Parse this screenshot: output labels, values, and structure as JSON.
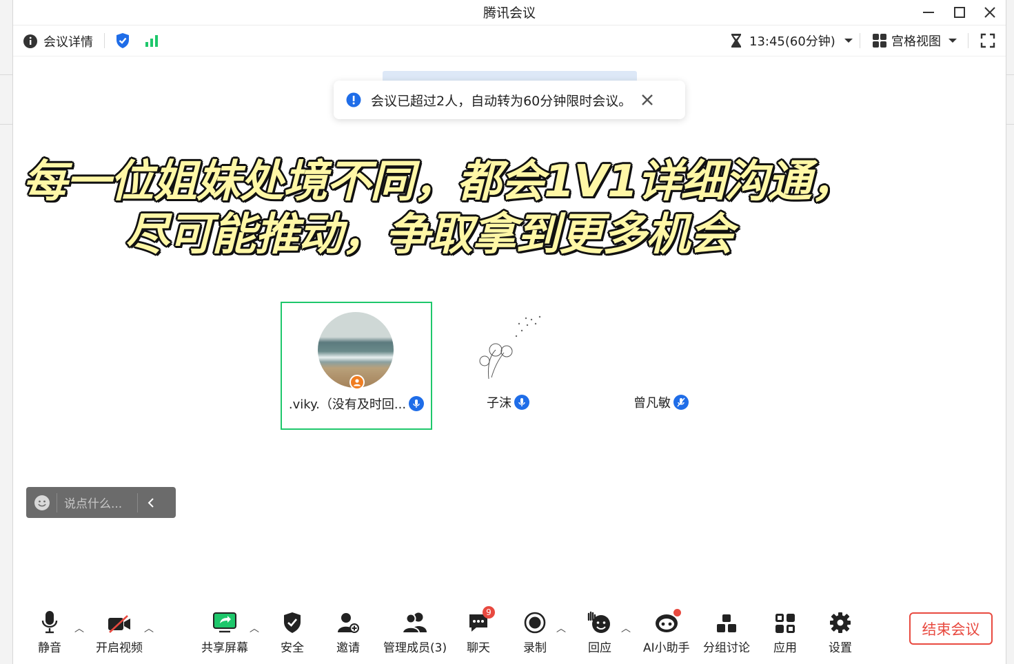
{
  "window": {
    "title": "腾讯会议"
  },
  "infobar": {
    "meeting_details": "会议详情",
    "timer": "13:45(60分钟)",
    "view_mode": "宫格视图"
  },
  "toast": {
    "message": "会议已超过2人，自动转为60分钟限时会议。"
  },
  "banner": {
    "line1": "每一位姐妹处境不同，都会1V1详细沟通，",
    "line2": "尽可能推动，争取拿到更多机会"
  },
  "participants": [
    {
      "name": ".viky.（没有及时回..."
    },
    {
      "name": "子沫"
    },
    {
      "name": "曾凡敏"
    }
  ],
  "chat": {
    "placeholder": "说点什么..."
  },
  "toolbar": {
    "mute": "静音",
    "video": "开启视频",
    "share": "共享屏幕",
    "security": "安全",
    "invite": "邀请",
    "members": "管理成员(3)",
    "chat": "聊天",
    "chat_badge": "9",
    "record": "录制",
    "react": "回应",
    "ai": "AI小助手",
    "breakout": "分组讨论",
    "apps": "应用",
    "settings": "设置",
    "end": "结束会议"
  },
  "colors": {
    "accent_green": "#1ec76b",
    "mic_blue": "#1f6de8",
    "end_red": "#e8493f"
  }
}
